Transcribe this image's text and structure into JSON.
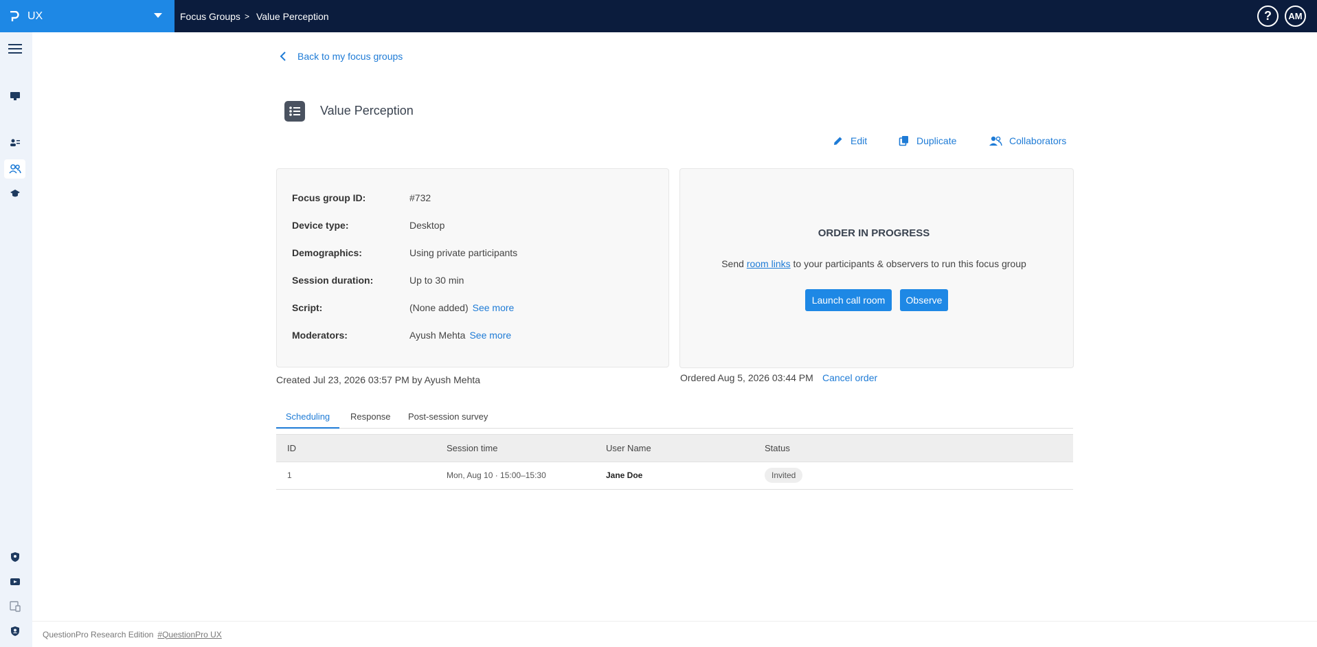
{
  "header": {
    "app_name": "UX",
    "breadcrumb_parent": "Focus Groups",
    "breadcrumb_separator": ">",
    "breadcrumb_current": "Value Perception",
    "help_label": "?",
    "avatar_initials": "AM"
  },
  "sidebar": {
    "items": [
      "menu-icon",
      "monitor-icon",
      "participants-icon",
      "focus-groups-icon",
      "education-icon",
      "shield-icon",
      "video-icon",
      "mobile-device-icon",
      "shield-account-icon"
    ],
    "active_item": "focus-groups-icon"
  },
  "main": {
    "back_label": "Back to my focus groups",
    "title": "Value Perception",
    "actions": {
      "edit": "Edit",
      "duplicate": "Duplicate",
      "collaborators": "Collaborators"
    },
    "details": [
      {
        "label": "Focus group ID:",
        "value": "#732"
      },
      {
        "label": "Device type:",
        "value": "Desktop"
      },
      {
        "label": "Demographics:",
        "value": "Using private participants"
      },
      {
        "label": "Session duration:",
        "value": "Up to 30 min"
      },
      {
        "label": "Script:",
        "value": "(None added)",
        "link": "See more"
      },
      {
        "label": "Moderators:",
        "value": "Ayush Mehta",
        "link": "See more"
      }
    ],
    "created_text": "Created Jul 23, 2026 03:57 PM by Ayush Mehta",
    "order": {
      "title": "ORDER IN PROGRESS",
      "desc_before": "Send ",
      "desc_link": "room links",
      "desc_after": " to your participants & observers to run this focus group",
      "launch_label": "Launch call room",
      "observe_label": "Observe",
      "ordered_text": "Ordered Aug 5, 2026 03:44 PM",
      "cancel_label": "Cancel order"
    },
    "tabs": [
      {
        "label": "Scheduling",
        "active": true
      },
      {
        "label": "Response",
        "active": false
      },
      {
        "label": "Post-session survey",
        "active": false
      }
    ],
    "table": {
      "columns": [
        "ID",
        "Session time",
        "User Name",
        "Status"
      ],
      "rows": [
        {
          "id": "1",
          "session_time": "Mon, Aug 10 · 15:00–15:30",
          "user_name": "Jane Doe",
          "status": "Invited"
        }
      ]
    }
  },
  "footer": {
    "edition": "QuestionPro Research Edition",
    "link": "#QuestionPro UX"
  },
  "colors": {
    "topbar": "#0b1c3d",
    "accent": "#1e88e5",
    "link": "#1e7bd6",
    "sidebar": "#eef3fa"
  }
}
